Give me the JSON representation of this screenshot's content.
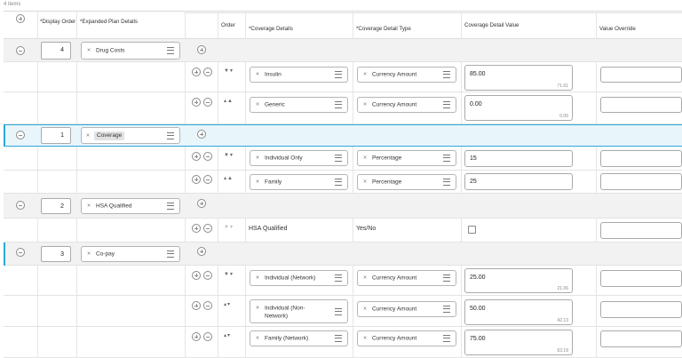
{
  "items_count": "4 items",
  "headers": {
    "display_order": "*Display Order",
    "plan_details": "*Expanded Plan Details",
    "order": "Order",
    "coverage_details": "*Coverage Details",
    "coverage_type": "*Coverage Detail Type",
    "coverage_value": "Coverage Detail Value",
    "value_override": "Value Override"
  },
  "rows": [
    {
      "display_order": "4",
      "plan": "Drug Costs"
    },
    {
      "detail": "Insulin",
      "type": "Currency Amount",
      "value": "85.00",
      "sub": "71.61"
    },
    {
      "detail": "Generic",
      "type": "Currency Amount",
      "value": "0.00",
      "sub": "0.00"
    },
    {
      "display_order": "1",
      "plan": "Coverage"
    },
    {
      "detail": "Individual Only",
      "type": "Percentage",
      "value": "15"
    },
    {
      "detail": "Family",
      "type": "Percentage",
      "value": "25"
    },
    {
      "display_order": "2",
      "plan": "HSA Qualified"
    },
    {
      "detail": "HSA Qualified",
      "type": "Yes/No"
    },
    {
      "display_order": "3",
      "plan": "Co-pay"
    },
    {
      "detail": "Individual (Network)",
      "type": "Currency Amount",
      "value": "25.00",
      "sub": "21.06"
    },
    {
      "detail_line1": "Individual (Non-",
      "detail_line2": "Network)",
      "type": "Currency Amount",
      "value": "50.00",
      "sub": "42.13"
    },
    {
      "detail": "Family (Network)",
      "type": "Currency Amount",
      "value": "75.00",
      "sub": "63.19"
    }
  ]
}
